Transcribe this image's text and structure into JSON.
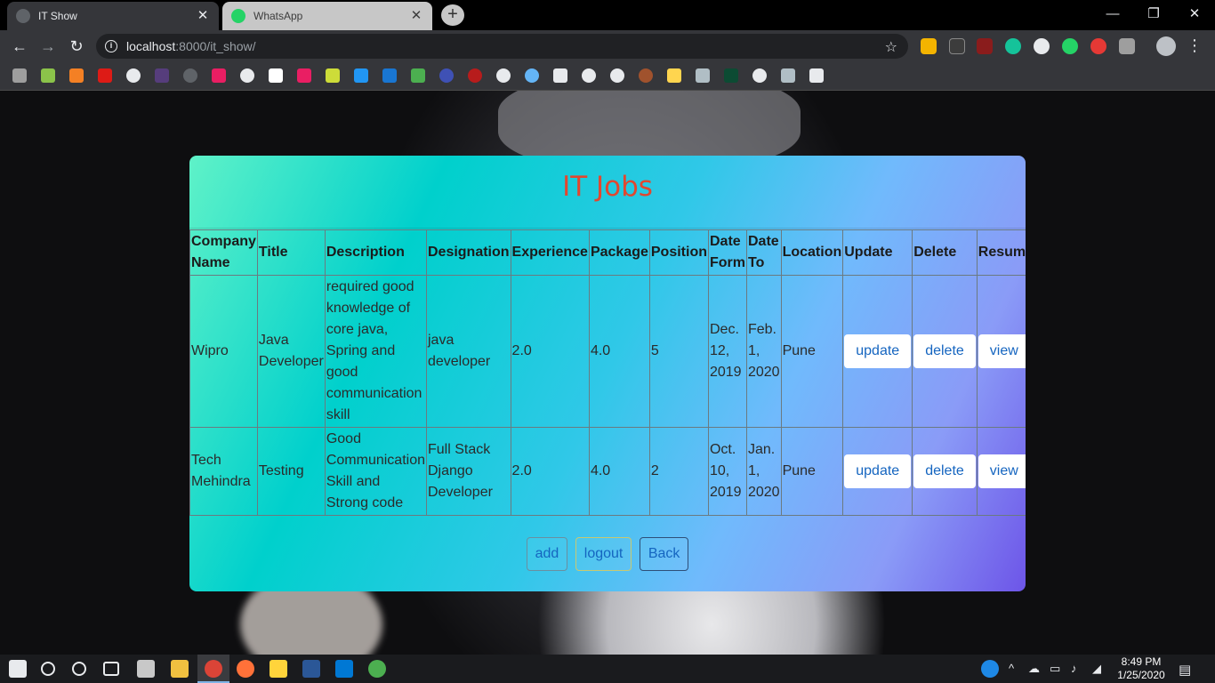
{
  "browser": {
    "tabs": [
      {
        "title": "IT Show",
        "icon": "globe-icon"
      },
      {
        "title": "WhatsApp",
        "icon": "whatsapp-icon"
      }
    ],
    "new_tab_symbol": "+",
    "address": {
      "host": "localhost",
      "path": ":8000/it_show/"
    },
    "window_controls": {
      "minimize": "—",
      "restore": "❐",
      "close": "✕"
    }
  },
  "page": {
    "title": "IT Jobs",
    "columns": [
      "Company Name",
      "Title",
      "Description",
      "Designation",
      "Experience",
      "Package",
      "Position",
      "Date Form",
      "Date To",
      "Location",
      "Update",
      "Delete",
      "Resume"
    ],
    "rows": [
      {
        "company": "Wipro",
        "title": "Java Developer",
        "description": "required good knowledge of core java, Spring and good communication skill",
        "designation": "java developer",
        "experience": "2.0",
        "package": "4.0",
        "position": "5",
        "date_from": "Dec. 12, 2019",
        "date_to": "Feb. 1, 2020",
        "location": "Pune",
        "update": "update",
        "delete": "delete",
        "resume": "view"
      },
      {
        "company": "Tech Mehindra",
        "title": "Testing",
        "description": "Good Communication Skill and Strong code",
        "designation": "Full Stack Django Developer",
        "experience": "2.0",
        "package": "4.0",
        "position": "2",
        "date_from": "Oct. 10, 2019",
        "date_to": "Jan. 1, 2020",
        "location": "Pune",
        "update": "update",
        "delete": "delete",
        "resume": "view"
      }
    ],
    "buttons": {
      "add": "add",
      "logout": "logout",
      "back": "Back"
    }
  },
  "taskbar": {
    "time": "8:49 PM",
    "date": "1/25/2020"
  },
  "colors": {
    "title": "#e2472f",
    "link": "#1565c0",
    "card_gradient_start": "#5ff2c8",
    "card_gradient_end": "#6d55e8"
  }
}
